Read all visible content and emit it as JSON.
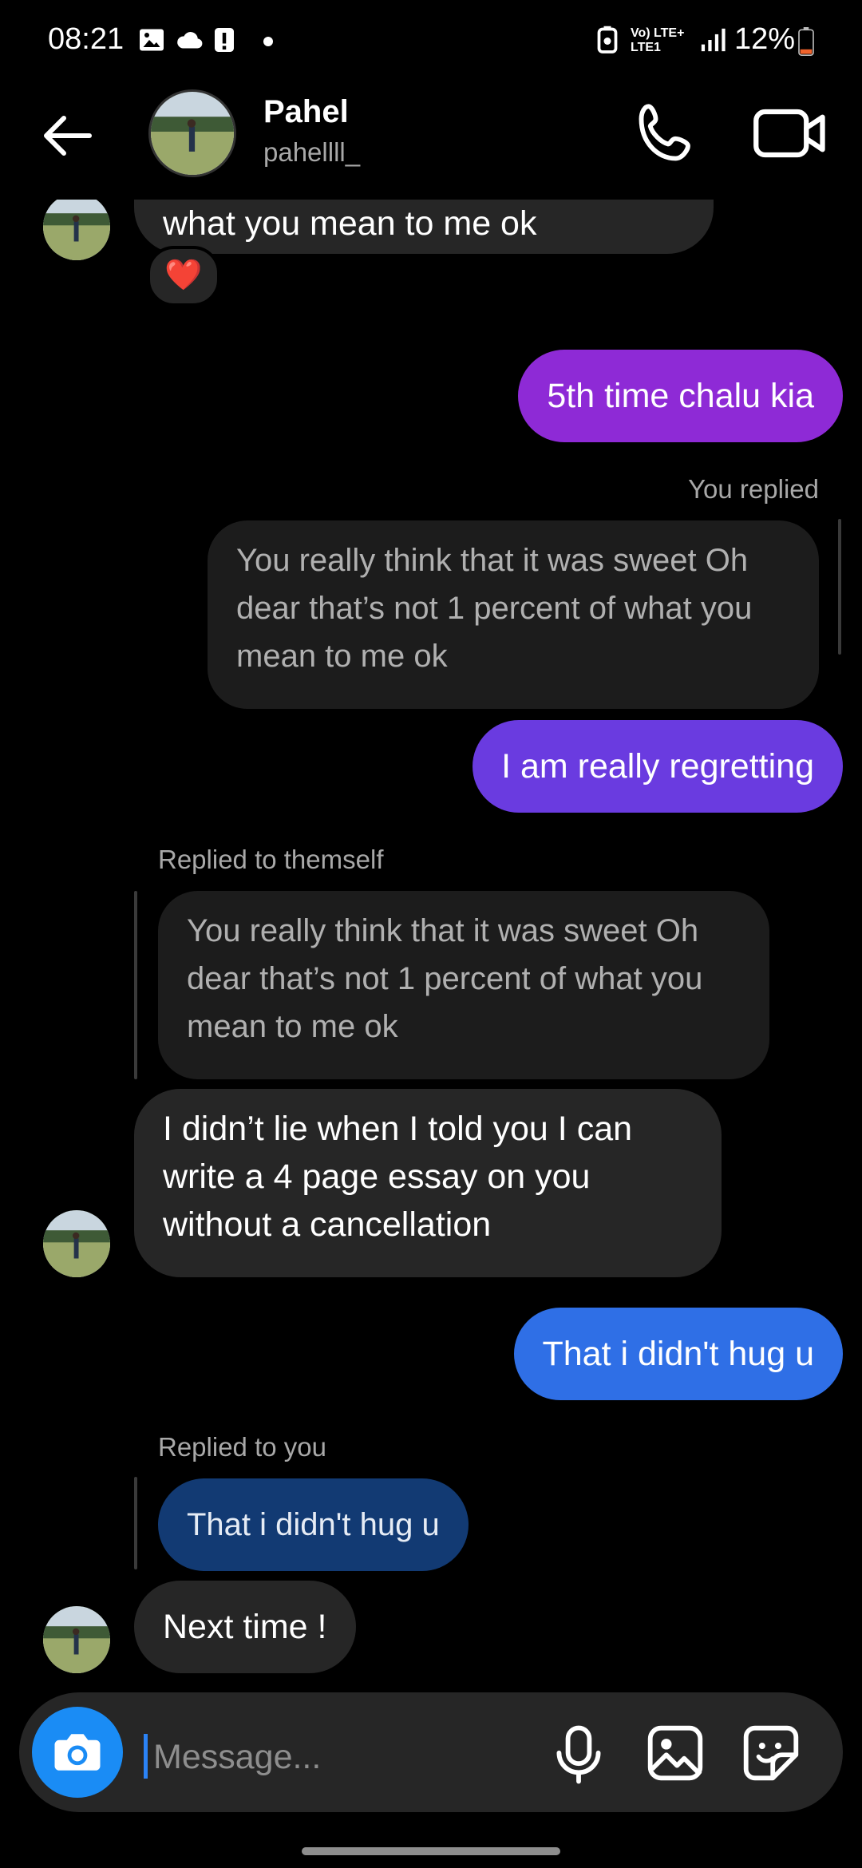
{
  "status_bar": {
    "time": "08:21",
    "network_top": "Vo) LTE+",
    "network_bottom": "LTE1",
    "battery": "12%"
  },
  "header": {
    "name": "Pahel",
    "username": "pahellll_"
  },
  "messages": {
    "m1_text": "what you mean to me ok",
    "m1_reaction": "❤️",
    "m2_text": "5th time chalu kia",
    "m3_meta": "You replied",
    "m3_quote": "You really think that it was sweet Oh dear that’s not 1 percent of what you mean to me ok",
    "m3_text": "I am really regretting",
    "m4_meta": "Replied to themself",
    "m4_quote": "You really think that it was sweet Oh dear that’s not 1 percent of what you mean to me ok",
    "m4_text": "I didn’t lie when I told you I can write a 4 page essay on you without a cancellation",
    "m5_text": "That i didn't hug u",
    "m6_meta": "Replied to you",
    "m6_quote": "That i didn't hug u",
    "m6_text": "Next time !"
  },
  "composer": {
    "placeholder": "Message..."
  },
  "colors": {
    "outgoing_1": "#8e2ad6",
    "outgoing_2": "#6a3be0",
    "outgoing_3": "#2f6fe6",
    "quoted_outgoing": "#123a73",
    "incoming": "#262626",
    "camera_button": "#1a8cf5"
  }
}
